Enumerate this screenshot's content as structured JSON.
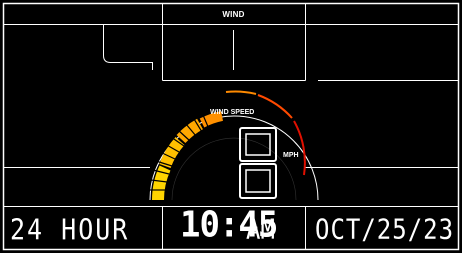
{
  "header": {
    "title": "WIND"
  },
  "gauge": {
    "label": "WIND SPEED",
    "value": "8",
    "unit": "MPH"
  },
  "footer": {
    "hour_mode": "24 HOUR",
    "time": "10:45",
    "ampm": "AM",
    "date": "OCT/25/23"
  },
  "colors": {
    "background": "#000000",
    "lines": "#ffffff",
    "gauge_low": "#ffd400",
    "gauge_mid": "#ff8a00",
    "gauge_high": "#e01000"
  }
}
